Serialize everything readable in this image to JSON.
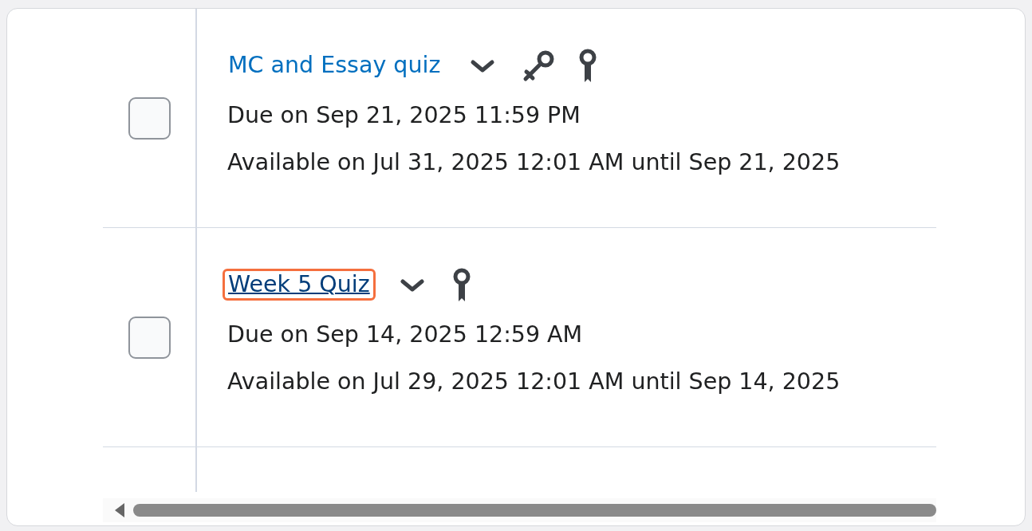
{
  "rows": [
    {
      "checked": false,
      "title": "MC and Essay quiz",
      "focused": false,
      "icons": [
        {
          "kind": "key"
        },
        {
          "kind": "ribbon"
        }
      ],
      "due": "Due on Sep 21, 2025 11:59 PM",
      "available": "Available on Jul 31, 2025 12:01 AM until Sep 21, 2025"
    },
    {
      "checked": false,
      "title": "Week 5 Quiz",
      "focused": true,
      "icons": [
        {
          "kind": "ribbon"
        }
      ],
      "due": "Due on Sep 14, 2025 12:59 AM",
      "available": "Available on Jul 29, 2025 12:01 AM until Sep 14, 2025"
    }
  ]
}
